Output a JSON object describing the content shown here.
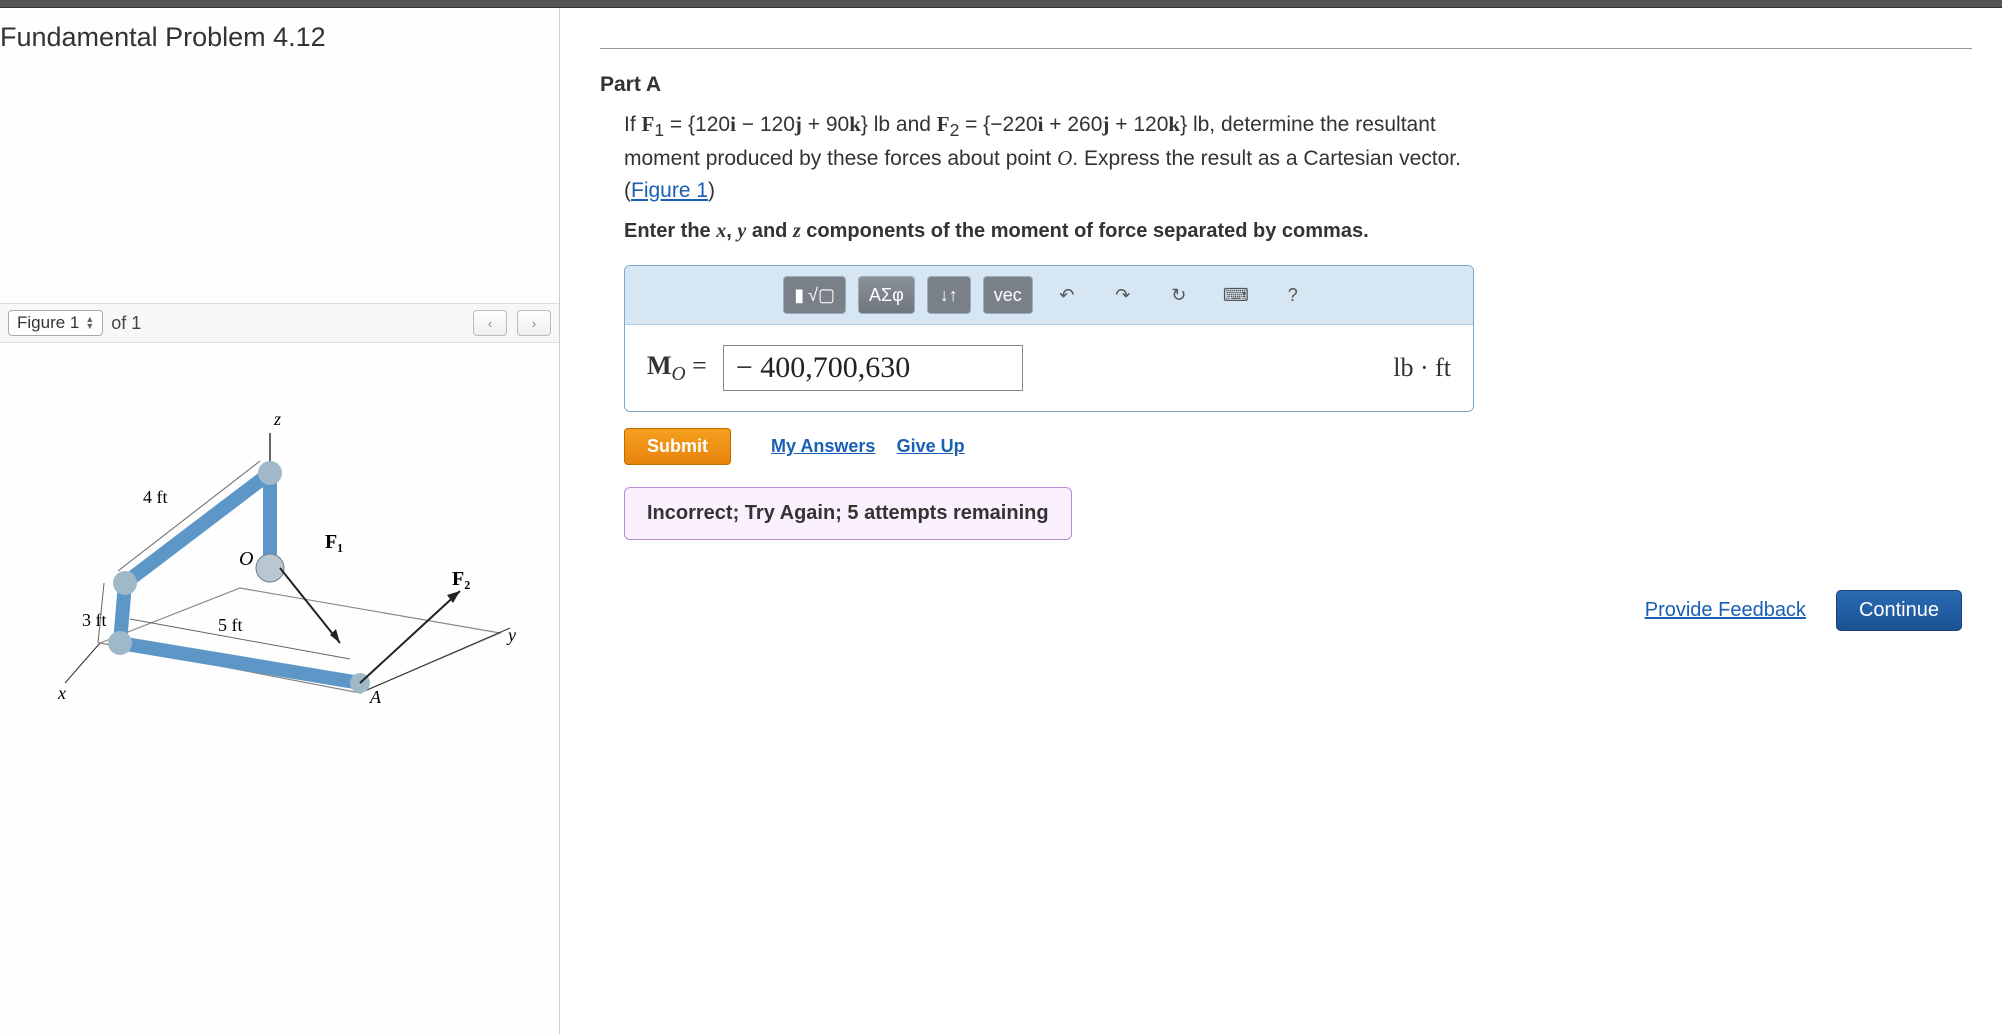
{
  "problem_title": "Fundamental Problem 4.12",
  "figure": {
    "label": "Figure 1",
    "of_text": "of 1",
    "dims": {
      "z_axis": "z",
      "y_axis": "y",
      "x_axis": "x"
    },
    "lengths": {
      "d1": "4 ft",
      "d2": "3 ft",
      "d3": "5 ft"
    },
    "points": {
      "O": "O",
      "A": "A"
    },
    "forces": {
      "F1": "F₁",
      "F2": "F₂"
    }
  },
  "partA": {
    "heading": "Part A",
    "text_pre": "If ",
    "F1_label": "F",
    "F1_sub": "1",
    "F1_eq": " = {120",
    "i": "i",
    "F1_mid1": " − 120",
    "j": "j",
    "F1_mid2": " + 90",
    "k": "k",
    "F1_end": "} lb and ",
    "F2_label": "F",
    "F2_sub": "2",
    "F2_eq": " = {−220",
    "F2_mid1": " + 260",
    "F2_mid2": " + 120",
    "F2_end": "} lb, determine the resultant moment produced by these forces about point ",
    "O_var": "O",
    "text_post": ". Express the result as a Cartesian vector. (",
    "fig_link": "Figure 1",
    "close": ")",
    "instruction_pre": "Enter the ",
    "x_var": "x",
    "instruction_mid1": ", ",
    "y_var": "y",
    "instruction_mid2": " and ",
    "z_var": "z",
    "instruction_post": " components of the moment of force separated by commas."
  },
  "toolbar": {
    "templates": "▮",
    "sqrt": "√▢",
    "greek": "ΑΣφ",
    "updown": "↓↑",
    "vec": "vec",
    "undo": "↶",
    "redo": "↷",
    "reset": "↻",
    "keyboard": "⌨",
    "help": "?"
  },
  "answer": {
    "label_html": "M",
    "sub": "O",
    "equals": " = ",
    "value": "− 400,700,630",
    "units": "lb · ft"
  },
  "buttons": {
    "submit": "Submit",
    "my_answers": "My Answers",
    "give_up": "Give Up",
    "provide_feedback": "Provide Feedback",
    "continue": "Continue"
  },
  "feedback": "Incorrect; Try Again; 5 attempts remaining"
}
